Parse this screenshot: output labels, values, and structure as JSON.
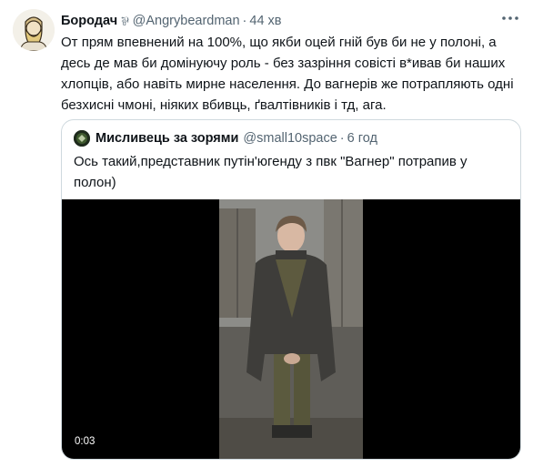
{
  "tweet": {
    "author_name": "Бородач",
    "flag": "⅌",
    "handle": "@Angrybeardman",
    "separator": "·",
    "time": "44 хв",
    "text": "От прям впевнений на 100%, що якби оцей гній був би не у полоні, а десь де мав би домінуючу роль - без зазріння совісті в*ивав би наших хлопців, або навіть мирне населення. До вагнерів же потрапляють одні безхисні чмоні, ніяких вбивць, ґвалтівників і тд, ага."
  },
  "quote": {
    "author_name": "Мисливець за зорями",
    "handle": "@small10space",
    "separator": "·",
    "time": "6 год",
    "text": "Ось такий,представник путін'югенду з пвк \"Вагнер\" потрапив у полон)",
    "video": {
      "timestamp": "0:03"
    }
  },
  "icons": {
    "more": "more-horizontal-icon",
    "avatar": "bearded-man-avatar",
    "quote_avatar": "green-badge-avatar"
  },
  "colors": {
    "text": "#0f1419",
    "secondary": "#536471",
    "border": "#cfd9de",
    "video_bg": "#000000"
  }
}
